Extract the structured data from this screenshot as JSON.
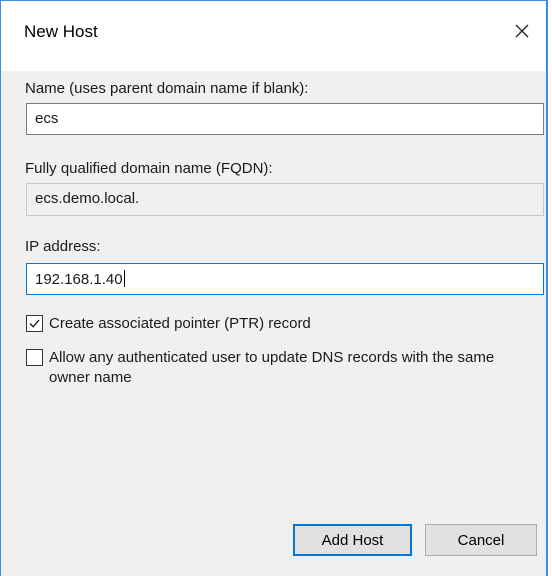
{
  "window": {
    "title": "New Host"
  },
  "name_field": {
    "label": "Name (uses parent domain name if blank):",
    "value": "ecs"
  },
  "fqdn_field": {
    "label": "Fully qualified domain name (FQDN):",
    "value": "ecs.demo.local."
  },
  "ip_field": {
    "label": "IP address:",
    "value": "192.168.1.40"
  },
  "checkboxes": [
    {
      "label": "Create associated pointer (PTR) record",
      "checked": true
    },
    {
      "label": "Allow any authenticated user to update DNS records with the same owner name",
      "checked": false
    }
  ],
  "buttons": {
    "add_host": "Add Host",
    "cancel": "Cancel"
  },
  "icons": {
    "close": "close-icon",
    "check": "checkmark-icon"
  },
  "colors": {
    "accent": "#0078d7",
    "window_border": "#3a8ee6",
    "dialog_bg": "#f0f0f0"
  }
}
